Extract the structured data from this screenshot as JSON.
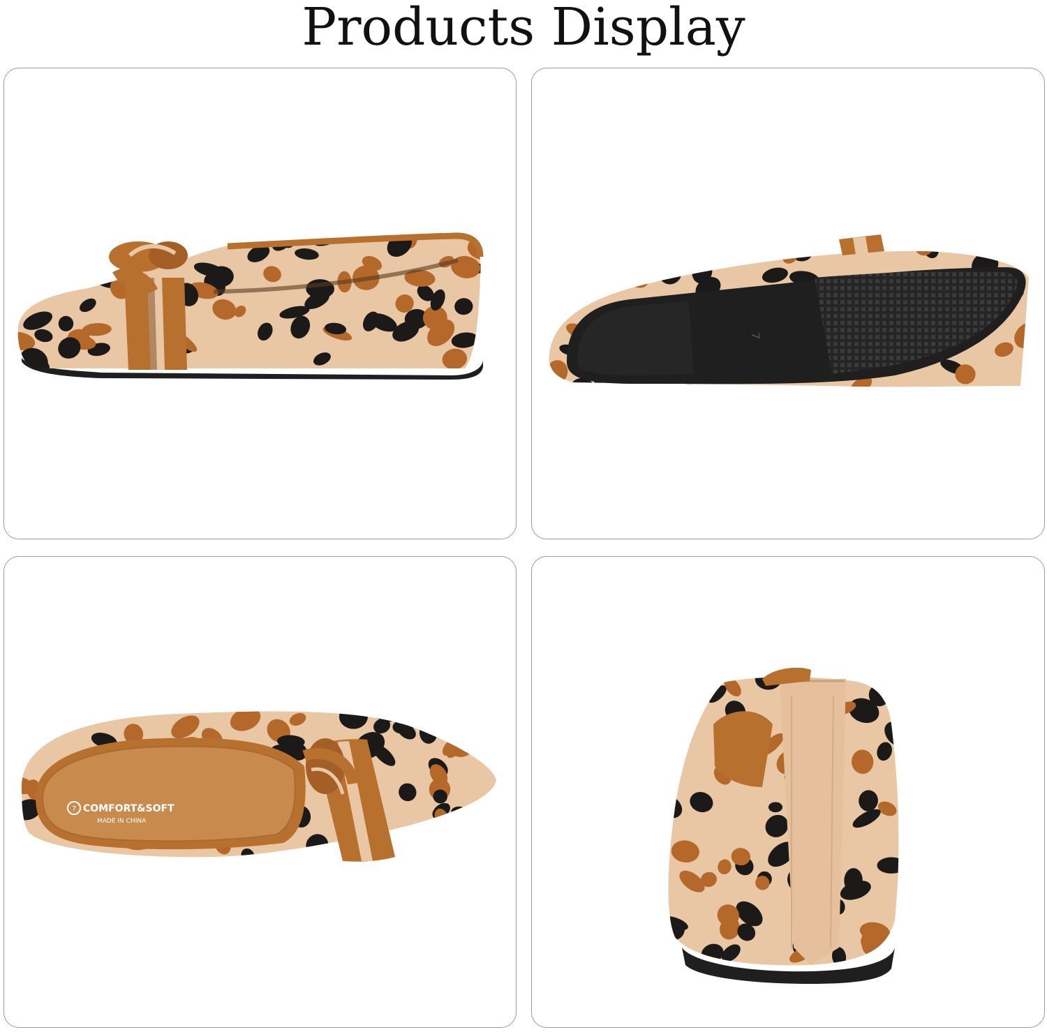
{
  "page": {
    "title": "Products Display"
  },
  "panels": [
    {
      "view": "side-view",
      "size_mark": ""
    },
    {
      "view": "sole-view",
      "size_mark": "7"
    },
    {
      "view": "top-view",
      "insole_brand": "COMFORT&SOFT",
      "insole_origin": "MADE IN CHINA",
      "insole_size": "7"
    },
    {
      "view": "rear-view"
    }
  ],
  "colors": {
    "knit_base": "#e9c7a5",
    "spot_black": "#1c1a18",
    "spot_brown": "#b4682a",
    "trim_brown": "#b8702f",
    "sole_black": "#1f1f1f",
    "panel_border": "#9a9a9a"
  }
}
